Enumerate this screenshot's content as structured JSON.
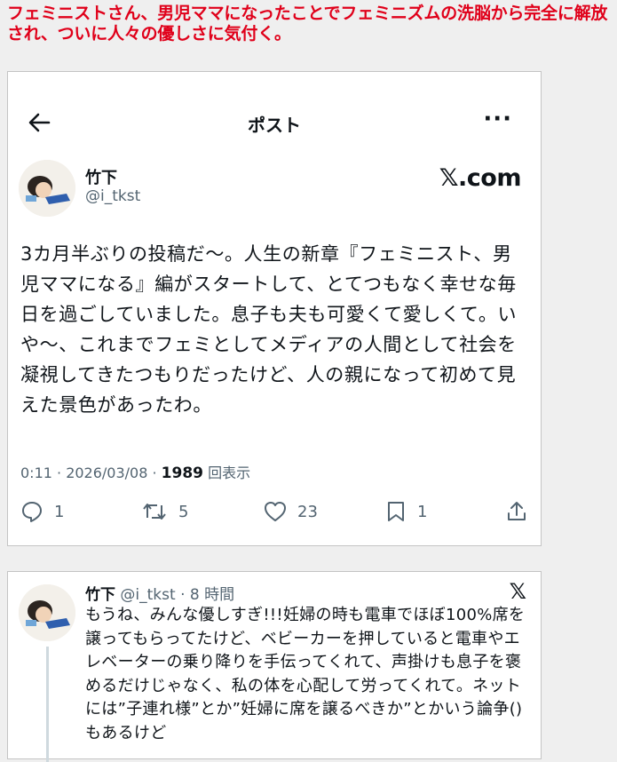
{
  "headline": "フェミニストさん、男児ママになったことでフェミニズムの洗脳から完全に解放され、ついに人々の優しさに気付く。",
  "post": {
    "nav_title": "ポスト",
    "more": "···",
    "author_name": "竹下",
    "handle": "@i_tkst",
    "brand": "𝕏.com",
    "text": "3カ月半ぶりの投稿だ〜。人生の新章『フェミニスト、男児ママになる』編がスタートして、とてつもなく幸せな毎日を過ごしていました。息子も夫も可愛くて愛しくて。いや〜、これまでフェミとしてメディアの人間として社会を凝視してきたつもりだったけど、人の親になって初めて見えた景色があったわ。",
    "time": "0:11 · 2026/03/08 · ",
    "views_count": "1989",
    "views_label": " 回表示",
    "replies": "1",
    "reposts": "5",
    "likes": "23",
    "bookmarks": "1"
  },
  "reply": {
    "author_name": "竹下",
    "handle_time": " @i_tkst · 8 時間",
    "brand": "𝕏",
    "text": "もうね、みんな優しすぎ!!!妊婦の時も電車でほぼ100%席を譲ってもらってたけど、ベビーカーを押していると電車やエレベーターの乗り降りを手伝ってくれて、声掛けも息子を褒めるだけじゃなく、私の体を心配して労ってくれて。ネットには”子連れ様”とか”妊婦に席を譲るべきか”とかいう論争()もあるけど"
  },
  "colors": {
    "headline": "#e0001a",
    "text": "#0f1419",
    "muted": "#536471",
    "border": "#c4c4c4",
    "page": "#efefef"
  },
  "icons": [
    "back-arrow-icon",
    "more-icon",
    "reply-icon",
    "repost-icon",
    "like-icon",
    "bookmark-icon",
    "share-icon"
  ]
}
